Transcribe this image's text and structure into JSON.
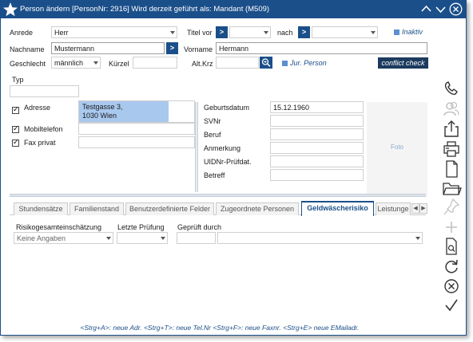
{
  "window": {
    "title": "Person ändern  [PersonNr: 2916] Wird derzeit geführt als: Mandant (M509)"
  },
  "form": {
    "anrede": {
      "label": "Anrede",
      "value": "Herr"
    },
    "titel_vor": {
      "label": "Titel vor",
      "button": ">",
      "value": ""
    },
    "nach": {
      "label": "nach",
      "button": ">",
      "value": ""
    },
    "inaktiv_label": "Inaktiv",
    "nachname": {
      "label": "Nachname",
      "value": "Mustermann",
      "button": ">"
    },
    "vorname": {
      "label": "Vorname",
      "value": "Hermann"
    },
    "geschlecht": {
      "label": "Geschlecht",
      "value": "männlich"
    },
    "kuerzel": {
      "label": "Kürzel",
      "value": ""
    },
    "altkrz": {
      "label": "Alt.Krz",
      "value": ""
    },
    "jur_person_label": "Jur. Person",
    "conflict_check": "conflict check",
    "typ": {
      "label": "Typ",
      "value": ""
    }
  },
  "contact": {
    "adresse": {
      "label": "Adresse",
      "checked": true,
      "line1": "Testgasse 3,",
      "line2": "1030 Wien"
    },
    "mobil": {
      "label": "Mobiltelefon",
      "checked": true,
      "value": ""
    },
    "fax": {
      "label": "Fax privat",
      "checked": true,
      "value": ""
    }
  },
  "details": {
    "geburtsdatum": {
      "label": "Geburtsdatum",
      "value": "15.12.1960"
    },
    "svnr": {
      "label": "SVNr",
      "value": ""
    },
    "beruf": {
      "label": "Beruf",
      "value": ""
    },
    "anmerkung": {
      "label": "Anmerkung",
      "value": ""
    },
    "uid": {
      "label": "UIDNr-Prüfdat.",
      "value": ""
    },
    "betreff": {
      "label": "Betreff",
      "value": ""
    },
    "foto": "Foto"
  },
  "tabs": [
    {
      "label": "Stundensätze",
      "active": false
    },
    {
      "label": "Familienstand",
      "active": false
    },
    {
      "label": "Benutzerdefinierte Felder",
      "active": false
    },
    {
      "label": "Zugeordnete Personen",
      "active": false
    },
    {
      "label": "Geldwäscherisiko",
      "active": true
    },
    {
      "label": "Leistunge",
      "active": false
    }
  ],
  "geldwaesche": {
    "risiko": {
      "label": "Risikogesamteinschätzung",
      "value": "Keine Angaben"
    },
    "pruefung": {
      "label": "Letzte Prüfung",
      "value": ""
    },
    "geprueft": {
      "label": "Geprüft durch",
      "value1": "",
      "value2": ""
    }
  },
  "footer_hint": "<Strg+A>: neue Adr. <Strg+T>: neue Tel.Nr <Strg+F>: neue Faxnr. <Strg+E> neue EMailadr.",
  "sidebar": {
    "icons": [
      "phone-icon",
      "users-icon",
      "share-icon",
      "print-icon",
      "document-icon",
      "folder-icon",
      "pin-icon",
      "plus-icon",
      "search-document-icon",
      "refresh-icon",
      "cancel-icon",
      "check-icon"
    ]
  },
  "colors": {
    "accent": "#1b4f8a",
    "selection": "#a9c8ee"
  }
}
